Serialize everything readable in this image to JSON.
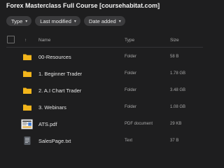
{
  "page": {
    "title": "Forex Masterclass Full Course [coursehabitat.com]"
  },
  "filters": [
    {
      "label": "Type",
      "caret": "▾"
    },
    {
      "label": "Last modified",
      "caret": "▾"
    },
    {
      "label": "Date added",
      "caret": "▾"
    }
  ],
  "columns": {
    "sort_arrow": "↑",
    "name": "Name",
    "type": "Type",
    "size": "Size"
  },
  "files": [
    {
      "name": "00-Resources",
      "type": "Folder",
      "size": "58 B",
      "icon": "folder-icon"
    },
    {
      "name": "1. Beginner Trader",
      "type": "Folder",
      "size": "1.78 GB",
      "icon": "folder-icon"
    },
    {
      "name": "2. A.I Chart Trader",
      "type": "Folder",
      "size": "3.48 GB",
      "icon": "folder-icon"
    },
    {
      "name": "3. Webinars",
      "type": "Folder",
      "size": "1.08 GB",
      "icon": "folder-icon"
    },
    {
      "name": "ATS.pdf",
      "type": "PDF document",
      "size": "29 KB",
      "icon": "pdf-thumbnail-icon"
    },
    {
      "name": "SalesPage.txt",
      "type": "Text",
      "size": "37 B",
      "icon": "text-file-icon"
    }
  ],
  "colors": {
    "background": "#1e1e1f",
    "folder": "#f2b51b",
    "chip": "#3b3b3d"
  }
}
